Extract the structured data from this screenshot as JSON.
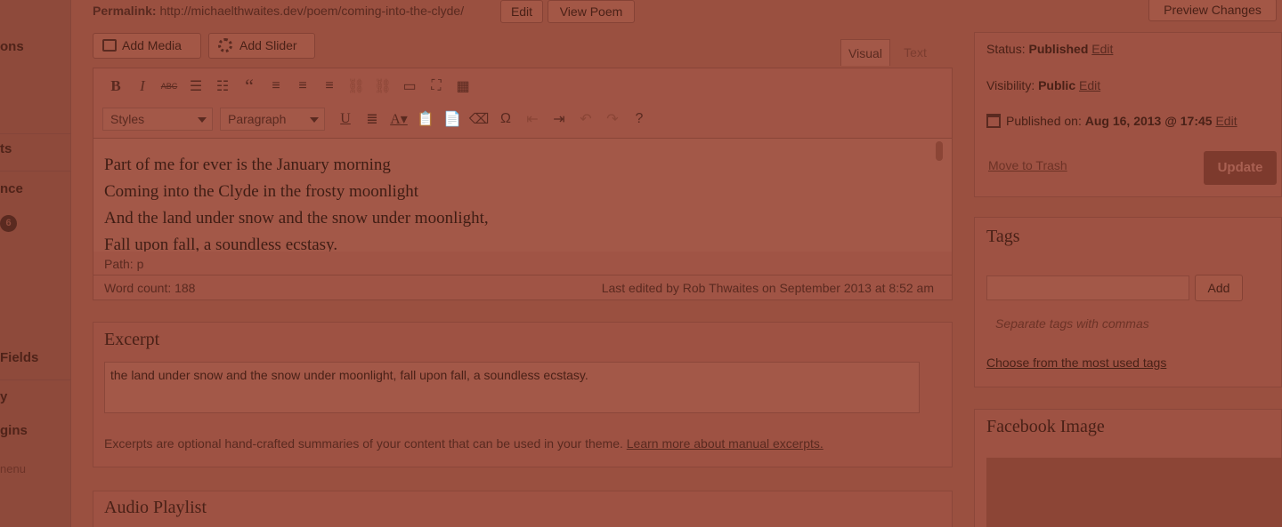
{
  "admin_menu": {
    "fragments": [
      "ons",
      "ts",
      "nce",
      "Fields",
      "y",
      "gins",
      "nenu"
    ],
    "badge": "6"
  },
  "permalink": {
    "label": "Permalink:",
    "url": "http://michaelthwaites.dev/poem/coming-into-the-clyde/",
    "edit_button": "Edit",
    "view_button": "View Poem"
  },
  "preview_button": "Preview Changes",
  "media": {
    "add_media": "Add Media",
    "add_slider": "Add Slider"
  },
  "editor_tabs": {
    "visual": "Visual",
    "text": "Text"
  },
  "toolbar": {
    "row1_icons": [
      "bold-icon",
      "italic-icon",
      "strikethrough-icon",
      "bullet-list-icon",
      "numbered-list-icon",
      "blockquote-icon",
      "align-left-icon",
      "align-center-icon",
      "align-right-icon",
      "link-icon",
      "unlink-icon",
      "more-tag-icon",
      "fullscreen-icon",
      "toolbar-toggle-icon"
    ],
    "styles_select": "Styles",
    "format_select": "Paragraph",
    "row2_icons": [
      "underline-icon",
      "justify-icon",
      "text-color-icon",
      "paste-text-icon",
      "paste-word-icon",
      "clear-formatting-icon",
      "special-character-icon",
      "outdent-icon",
      "indent-icon",
      "undo-icon",
      "redo-icon",
      "help-icon"
    ]
  },
  "editor": {
    "lines": [
      "Part of me for ever is the January morning",
      "Coming into the Clyde in the frosty moonlight",
      "And the land under snow and the snow under moonlight,",
      "Fall upon fall, a soundless ecstasy."
    ],
    "path": "Path: p",
    "word_count": "Word count: 188",
    "last_edited": "Last edited by Rob Thwaites on September 2013 at 8:52 am"
  },
  "excerpt": {
    "title": "Excerpt",
    "value": "the land under snow and the snow under moonlight, fall upon fall, a soundless ecstasy.",
    "help": "Excerpts are optional hand-crafted summaries of your content that can be used in your theme.",
    "help_link": "Learn more about manual excerpts."
  },
  "audio_playlist": {
    "title": "Audio Playlist"
  },
  "publish": {
    "status_label": "Status:",
    "status_value": "Published",
    "status_edit": "Edit",
    "visibility_label": "Visibility:",
    "visibility_value": "Public",
    "visibility_edit": "Edit",
    "published_label": "Published on:",
    "published_value": "Aug 16, 2013 @ 17:45",
    "published_edit": "Edit",
    "trash": "Move to Trash",
    "update": "Update"
  },
  "tags": {
    "title": "Tags",
    "add_button": "Add",
    "hint": "Separate tags with commas",
    "choose_link": "Choose from the most used tags"
  },
  "facebook_image": {
    "title": "Facebook Image"
  }
}
